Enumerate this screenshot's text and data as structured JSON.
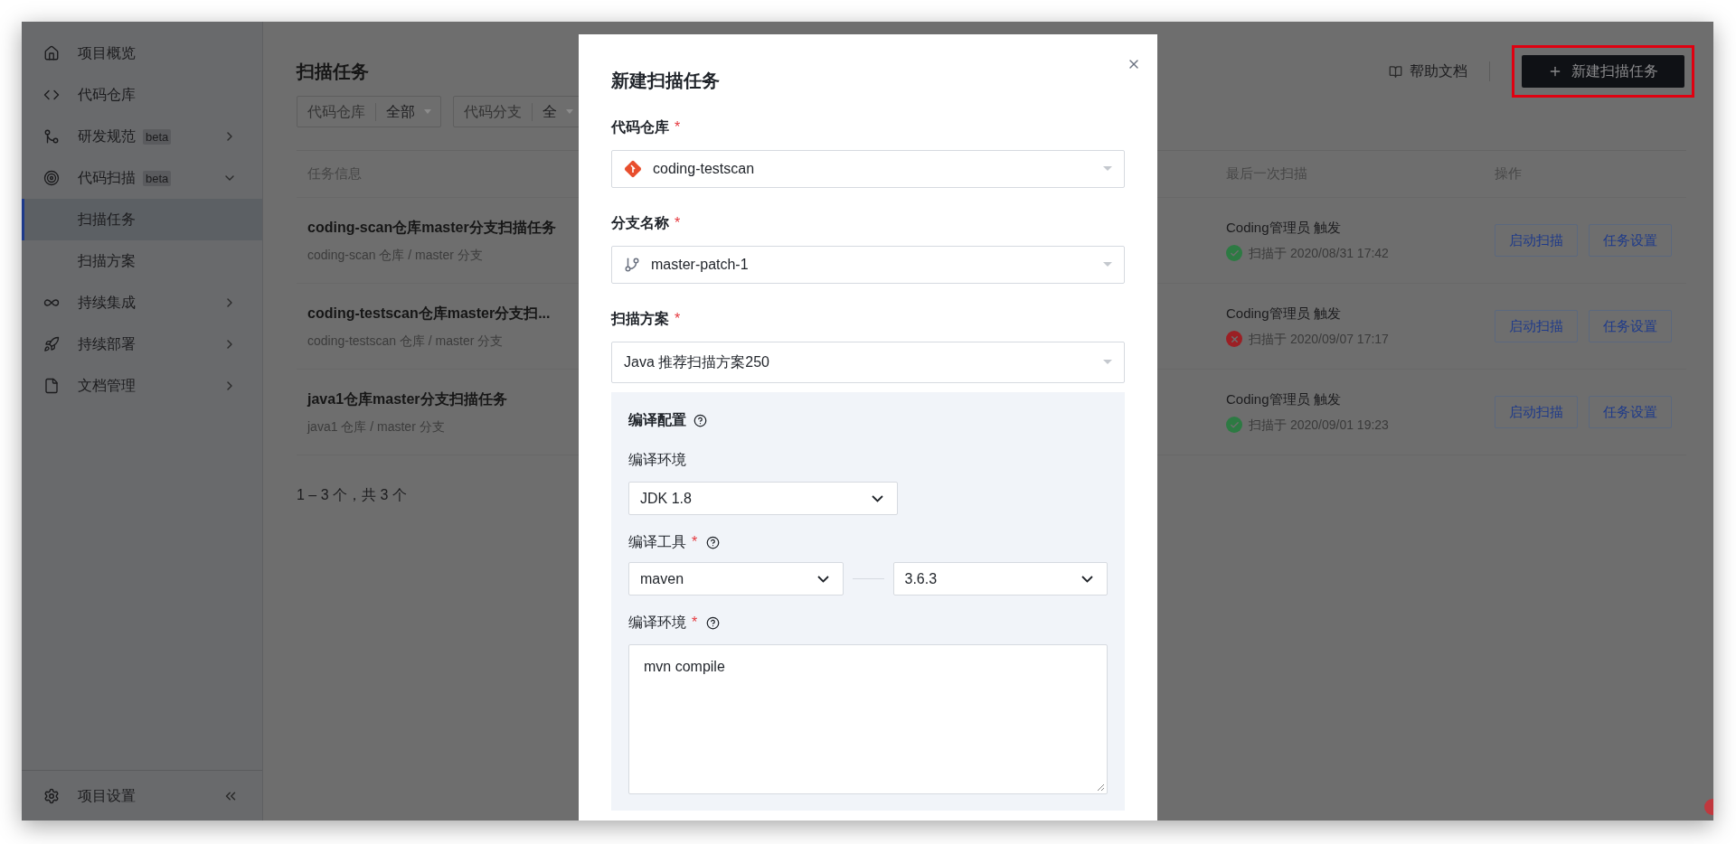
{
  "sidebar": {
    "items": [
      {
        "label": "项目概览",
        "kind": "link",
        "selected": false
      },
      {
        "label": "代码仓库",
        "kind": "link",
        "selected": false
      },
      {
        "label": "研发规范",
        "kind": "group",
        "badge": "beta",
        "expanded": false
      },
      {
        "label": "代码扫描",
        "kind": "group",
        "badge": "beta",
        "expanded": true,
        "children": [
          {
            "label": "扫描任务",
            "selected": true
          },
          {
            "label": "扫描方案",
            "selected": false
          }
        ]
      },
      {
        "label": "持续集成",
        "kind": "group",
        "expanded": false
      },
      {
        "label": "持续部署",
        "kind": "group",
        "expanded": false
      },
      {
        "label": "文档管理",
        "kind": "group",
        "expanded": false
      }
    ],
    "footer": {
      "label": "项目设置"
    }
  },
  "page_title": "扫描任务",
  "help_link": "帮助文档",
  "new_button": {
    "label": "新建扫描任务",
    "highlighted": true
  },
  "filters": [
    {
      "label": "代码仓库",
      "value": "全部"
    },
    {
      "label": "代码分支",
      "value": "全"
    }
  ],
  "table": {
    "columns": [
      "任务信息",
      "最后一次扫描",
      "操作"
    ],
    "rows": [
      {
        "title": "coding-scan仓库master分支扫描任务",
        "subtitle": "coding-scan 仓库 / master 分支",
        "trigger": "Coding管理员 触发",
        "failed": false,
        "scan_time": "扫描于 2020/08/31 17:42",
        "actions": [
          "启动扫描",
          "任务设置"
        ]
      },
      {
        "title": "coding-testscan仓库master分支扫...",
        "subtitle": "coding-testscan 仓库 / master 分支",
        "trigger": "Coding管理员 触发",
        "failed": true,
        "scan_time": "扫描于 2020/09/07 17:17",
        "actions": [
          "启动扫描",
          "任务设置"
        ]
      },
      {
        "title": "java1仓库master分支扫描任务",
        "subtitle": "java1 仓库 / master 分支",
        "trigger": "Coding管理员 触发",
        "failed": false,
        "scan_time": "扫描于 2020/09/01 19:23",
        "actions": [
          "启动扫描",
          "任务设置"
        ]
      }
    ]
  },
  "pagination": "1 – 3 个，共 3 个",
  "modal": {
    "title": "新建扫描任务",
    "fields": [
      {
        "label": "代码仓库",
        "required_mark": "*",
        "kind": "repository",
        "value": "coding-testscan"
      },
      {
        "label": "分支名称",
        "required_mark": "*",
        "kind": "branch",
        "value": "master-patch-1"
      },
      {
        "label": "扫描方案",
        "required_mark": "*",
        "kind": "plan",
        "value": "Java 推荐扫描方案250"
      }
    ],
    "compile_config": {
      "title": "编译配置",
      "items": [
        {
          "label": "编译环境",
          "help": false,
          "kind": "select",
          "value": "JDK 1.8"
        },
        {
          "label": "编译工具",
          "required_mark": "*",
          "help": true,
          "kind": "select-pair",
          "values": [
            "maven",
            "3.6.3"
          ]
        },
        {
          "label": "编译环境",
          "required_mark": "*",
          "help": true,
          "kind": "textarea",
          "value": "mvn compile"
        }
      ]
    }
  }
}
